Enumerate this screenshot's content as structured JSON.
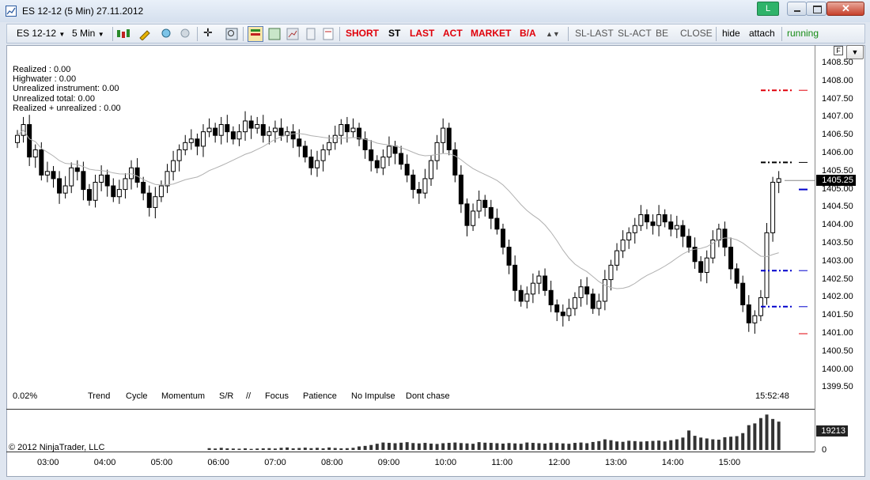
{
  "window": {
    "title": "ES 12-12 (5 Min)  27.11.2012",
    "badge": "L"
  },
  "toolbar": {
    "instrument": "ES 12-12",
    "interval": "5 Min",
    "orders": [
      "SHORT",
      "ST",
      "LAST",
      "ACT",
      "MARKET",
      "B/A"
    ],
    "right_items": [
      "SL-LAST",
      "SL-ACT",
      "BE",
      "CLOSE"
    ],
    "hide_label": "hide",
    "attach_label": "attach",
    "status": "running"
  },
  "stats": [
    "Realized : 0.00",
    "Highwater : 0.00",
    "Unrealized instrument: 0.00",
    "Unrealized total: 0.00",
    "Realized + unrealized : 0.00"
  ],
  "strategy_bar": {
    "pct": "0.02%",
    "items": [
      "Trend",
      "Cycle",
      "Momentum",
      "S/R",
      "//",
      "Focus",
      "Patience",
      "No Impulse",
      "Dont chase"
    ],
    "clock": "15:52:48"
  },
  "copyright": "© 2012 NinjaTrader, LLC",
  "price_axis": [
    "1408.50",
    "1408.00",
    "1407.50",
    "1407.00",
    "1406.50",
    "1406.00",
    "1405.50",
    "1405.00",
    "1404.50",
    "1404.00",
    "1403.50",
    "1403.00",
    "1402.50",
    "1402.00",
    "1401.50",
    "1401.00",
    "1400.50",
    "1400.00",
    "1399.50"
  ],
  "time_axis": [
    "03:00",
    "04:00",
    "05:00",
    "06:00",
    "07:00",
    "08:00",
    "09:00",
    "10:00",
    "11:00",
    "12:00",
    "13:00",
    "14:00",
    "15:00"
  ],
  "last_price": "1405.25",
  "volume_label": "19213",
  "volume_zero": "0",
  "colors": {
    "red": "#e0000a",
    "blue": "#0000cc",
    "status_green": "#138a13"
  },
  "chart_data": {
    "type": "candlestick",
    "ylim": [
      1399.3,
      1408.8
    ],
    "levels": [
      {
        "price": 1407.75,
        "color": "#e0000a"
      },
      {
        "price": 1405.75,
        "color": "#000000"
      },
      {
        "price": 1402.75,
        "color": "#0000cc"
      },
      {
        "price": 1401.75,
        "color": "#0000cc"
      }
    ],
    "closes": [
      1406.5,
      1406.8,
      1405.9,
      1406.1,
      1405.4,
      1405.5,
      1405.3,
      1404.9,
      1405.1,
      1405.6,
      1405.5,
      1405.0,
      1404.7,
      1405.2,
      1405.4,
      1405.1,
      1404.8,
      1405.0,
      1405.3,
      1405.6,
      1405.2,
      1404.9,
      1404.5,
      1404.8,
      1405.1,
      1405.5,
      1405.8,
      1406.1,
      1406.3,
      1406.4,
      1406.2,
      1406.6,
      1406.7,
      1406.5,
      1406.8,
      1406.6,
      1406.4,
      1406.6,
      1406.9,
      1406.7,
      1406.8,
      1406.5,
      1406.6,
      1406.7,
      1406.5,
      1406.6,
      1406.4,
      1406.2,
      1405.9,
      1405.6,
      1405.8,
      1406.1,
      1406.3,
      1406.5,
      1406.8,
      1406.6,
      1406.7,
      1406.4,
      1406.1,
      1405.8,
      1405.6,
      1405.9,
      1406.2,
      1406.0,
      1405.7,
      1405.4,
      1405.0,
      1404.9,
      1405.3,
      1405.8,
      1406.3,
      1406.7,
      1406.1,
      1405.4,
      1404.6,
      1404.0,
      1404.4,
      1404.7,
      1404.5,
      1404.2,
      1403.9,
      1403.4,
      1402.9,
      1402.2,
      1401.9,
      1402.1,
      1402.4,
      1402.6,
      1402.2,
      1401.8,
      1401.6,
      1401.5,
      1401.7,
      1402.0,
      1402.3,
      1402.1,
      1401.7,
      1401.9,
      1402.5,
      1402.9,
      1403.3,
      1403.6,
      1403.8,
      1404.0,
      1404.3,
      1404.1,
      1404.0,
      1404.3,
      1404.1,
      1403.9,
      1404.0,
      1403.7,
      1403.4,
      1403.0,
      1402.7,
      1403.1,
      1403.6,
      1403.9,
      1403.4,
      1402.8,
      1402.4,
      1401.8,
      1401.3,
      1401.5,
      1402.0,
      1403.8,
      1405.2,
      1405.3
    ],
    "volumes": [
      10,
      8,
      12,
      9,
      8,
      7,
      9,
      6,
      8,
      9,
      10,
      8,
      12,
      14,
      9,
      11,
      13,
      10,
      12,
      9,
      14,
      11,
      9,
      10,
      12,
      20,
      23,
      28,
      35,
      42,
      40,
      38,
      41,
      44,
      39,
      37,
      40,
      36,
      34,
      38,
      40,
      42,
      39,
      37,
      35,
      44,
      41,
      40,
      38,
      36,
      39,
      37,
      35,
      42,
      40,
      38,
      36,
      41,
      39,
      37,
      35,
      40,
      42,
      38,
      45,
      50,
      60,
      55,
      48,
      46,
      52,
      50,
      47,
      49,
      51,
      53,
      48,
      55,
      60,
      70,
      110,
      80,
      70,
      65,
      60,
      58,
      72,
      75,
      78,
      95,
      140,
      150,
      180,
      200,
      175,
      160
    ]
  }
}
